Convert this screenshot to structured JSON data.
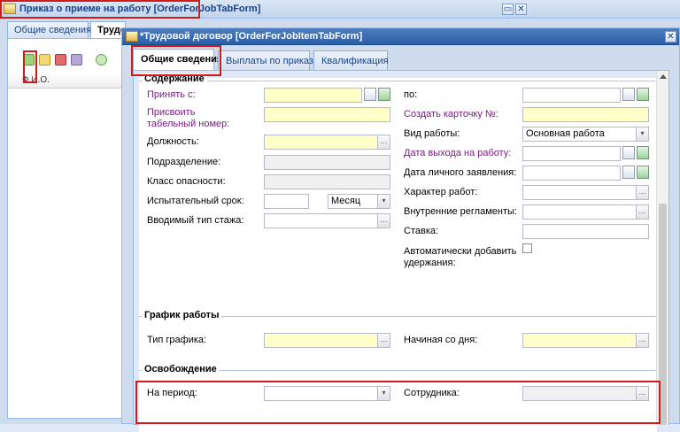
{
  "outer_window": {
    "title": "Приказ о приеме на работу [OrderForJobTabForm]",
    "tabs": [
      "Общие сведения",
      "Трудо"
    ],
    "grid_header": "Ф.И.О."
  },
  "inner_window": {
    "title": "*Трудовой договор [OrderForJobItemTabForm]",
    "tabs": [
      "Общие сведения",
      "Выплаты по приказу",
      "Квалификация"
    ]
  },
  "icons": {
    "minimize": "▭",
    "close": "✕",
    "trigger_dots": "…",
    "trigger_down": "▾"
  },
  "sections": {
    "content": {
      "title": "Содержание",
      "left": {
        "hire_from": "Принять с:",
        "assign_tab_no": "Присвоить табельный номер:",
        "position": "Должность:",
        "department": "Подразделение:",
        "hazard_class": "Класс опасности:",
        "probation": "Испытательный срок:",
        "probation_unit": "Месяц",
        "seniority_type": "Вводимый тип стажа:"
      },
      "right": {
        "to": "по:",
        "create_card": "Создать карточку №:",
        "work_type": "Вид работы:",
        "work_type_value": "Основная работа",
        "start_date": "Дата выхода на работу:",
        "application_date": "Дата личного заявления:",
        "work_character": "Характер работ:",
        "internal_rules": "Внутренние регламенты:",
        "rate": "Ставка:",
        "auto_deductions": "Автоматически добавить удержания:"
      }
    },
    "schedule": {
      "title": "График работы",
      "schedule_type": "Тип графика:",
      "start_day": "Начиная со дня:"
    },
    "release": {
      "title": "Освобождение",
      "period": "На период:",
      "employee": "Сотрудника:"
    }
  }
}
